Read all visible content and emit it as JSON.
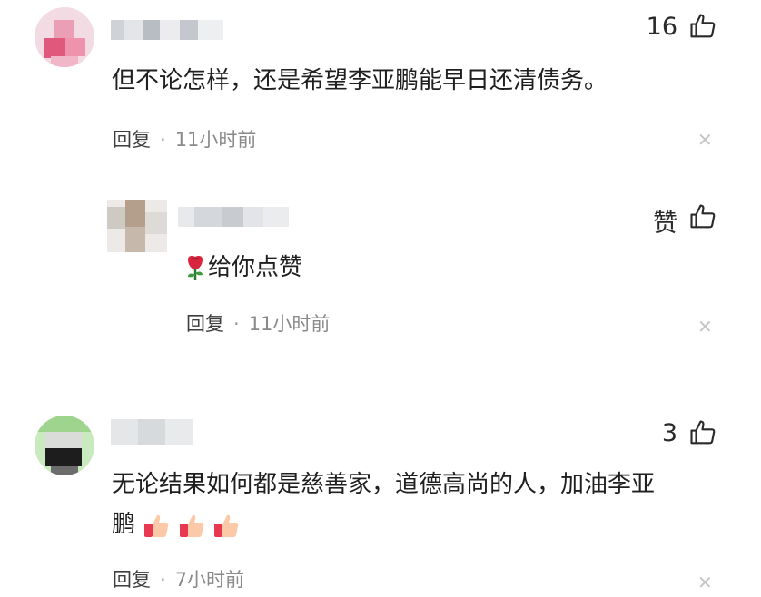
{
  "comments": [
    {
      "likes": "16",
      "text": "但不论怎样，还是希望李亚鹏能早日还清债务。",
      "reply_label": "回复",
      "separator": "·",
      "time": "11小时前"
    },
    {
      "likes": "赞",
      "text": "给你点赞",
      "reply_label": "回复",
      "separator": "·",
      "time": "11小时前"
    },
    {
      "likes": "3",
      "text_line1": "无论结果如何都是慈善家，道德高尚的人，加油李亚",
      "text_line2": "鹏",
      "reply_label": "回复",
      "separator": "·",
      "time": "7小时前"
    }
  ],
  "icons": {
    "like": "thumbs-up-icon",
    "close": "close-icon",
    "rose": "rose-icon",
    "clap": "thumbs-up-emoji"
  },
  "colors": {
    "text": "#1f1f1f",
    "time": "#8a8a8a",
    "close": "#c5c5c5"
  }
}
